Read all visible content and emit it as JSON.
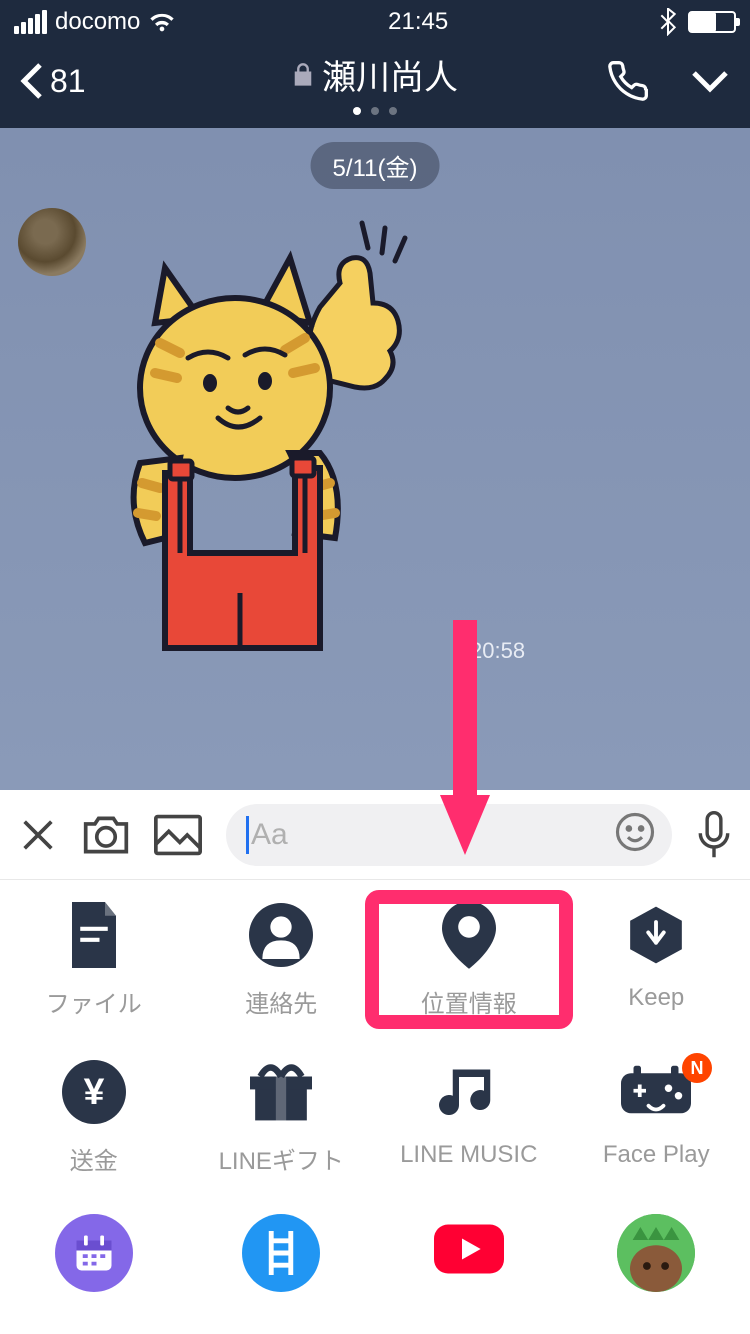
{
  "status": {
    "carrier": "docomo",
    "time": "21:45"
  },
  "header": {
    "back_count": "81",
    "title": "瀬川尚人"
  },
  "chat": {
    "date_label": "5/11(金)",
    "message_time": "20:58"
  },
  "input": {
    "placeholder": "Aa"
  },
  "attachments": {
    "items": [
      {
        "label": "ファイル",
        "icon": "file"
      },
      {
        "label": "連絡先",
        "icon": "contact"
      },
      {
        "label": "位置情報",
        "icon": "location",
        "highlighted": true
      },
      {
        "label": "Keep",
        "icon": "keep"
      },
      {
        "label": "送金",
        "icon": "yen"
      },
      {
        "label": "LINEギフト",
        "icon": "gift"
      },
      {
        "label": "LINE MUSIC",
        "icon": "music"
      },
      {
        "label": "Face Play",
        "icon": "faceplay",
        "badge": "N"
      }
    ]
  },
  "colors": {
    "header_bg": "#1e2a3e",
    "chat_bg": "#8a9ab8",
    "highlight": "#ff2d6e",
    "icon_dark": "#2a3548"
  }
}
